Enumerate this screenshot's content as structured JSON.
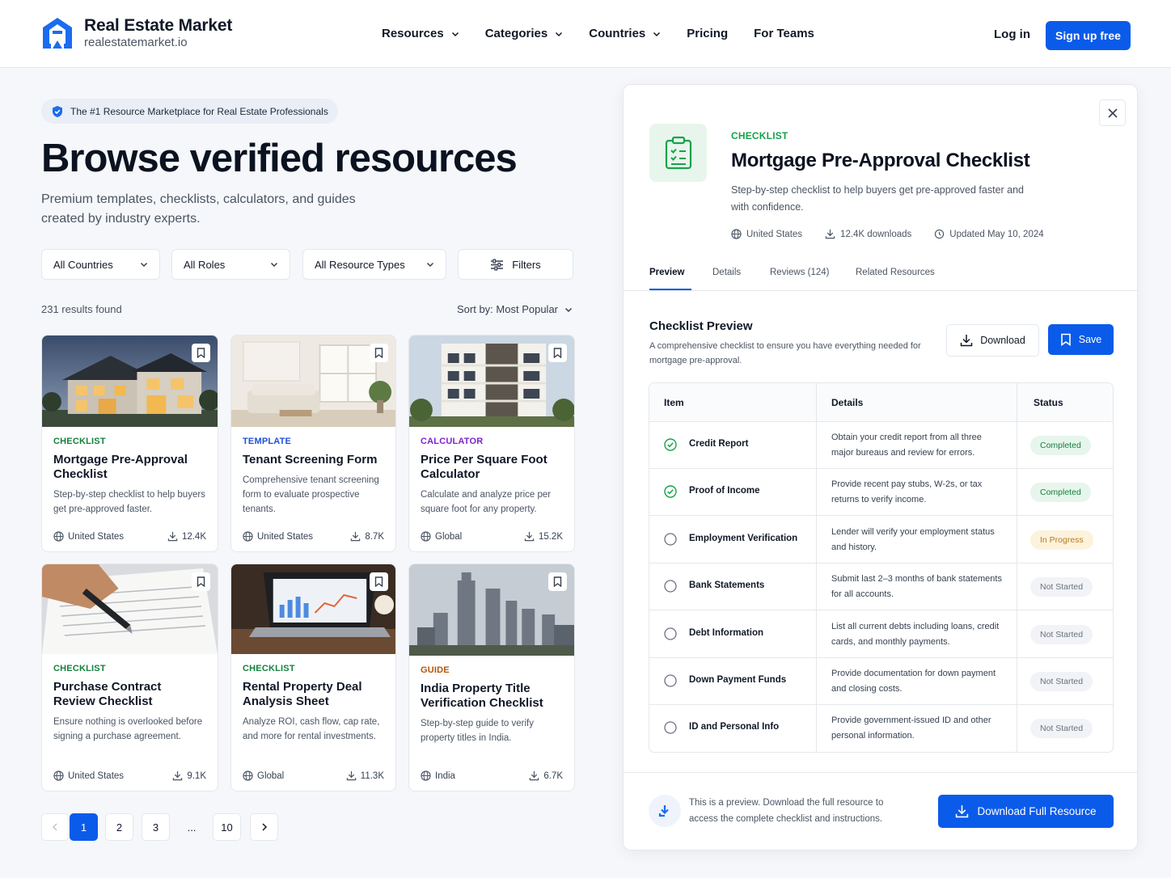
{
  "header": {
    "brand_name": "Real Estate Market",
    "brand_domain": "realestatemarket.io",
    "nav": [
      {
        "label": "Resources",
        "has_menu": true
      },
      {
        "label": "Categories",
        "has_menu": true
      },
      {
        "label": "Countries",
        "has_menu": true
      },
      {
        "label": "Pricing",
        "has_menu": false
      },
      {
        "label": "For Teams",
        "has_menu": false
      }
    ],
    "login": "Log in",
    "signup": "Sign up free"
  },
  "hero": {
    "badge": "The #1 Resource Marketplace for Real Estate Professionals",
    "title": "Browse verified resources",
    "subtitle": "Premium templates, checklists, calculators, and guides created by industry experts."
  },
  "filters": {
    "country": "All Countries",
    "roles": "All Roles",
    "types": "All Resource Types",
    "filters_label": "Filters"
  },
  "results": {
    "count_text": "231 results found",
    "sort_text": "Sort by: Most Popular"
  },
  "cards": [
    {
      "category": "CHECKLIST",
      "cat_color": "#15803d",
      "title": "Mortgage Pre-Approval Checklist",
      "desc": "Step-by-step checklist to help buyers get pre-approved faster.",
      "region": "United States",
      "downloads": "12.4K",
      "image": "house"
    },
    {
      "category": "TEMPLATE",
      "cat_color": "#1d4ed8",
      "title": "Tenant Screening Form",
      "desc": "Comprehensive tenant screening form to evaluate prospective tenants.",
      "region": "United States",
      "downloads": "8.7K",
      "image": "living-room"
    },
    {
      "category": "CALCULATOR",
      "cat_color": "#7e22ce",
      "title": "Price Per Square Foot Calculator",
      "desc": "Calculate and analyze price per square foot for any property.",
      "region": "Global",
      "downloads": "15.2K",
      "image": "apartment"
    },
    {
      "category": "CHECKLIST",
      "cat_color": "#15803d",
      "title": "Purchase Contract Review Checklist",
      "desc": "Ensure nothing is overlooked before signing a purchase agreement.",
      "region": "United States",
      "downloads": "9.1K",
      "image": "contract"
    },
    {
      "category": "CHECKLIST",
      "cat_color": "#15803d",
      "title": "Rental Property Deal Analysis Sheet",
      "desc": "Analyze ROI, cash flow, cap rate, and more for rental investments.",
      "region": "Global",
      "downloads": "11.3K",
      "image": "laptop"
    },
    {
      "category": "GUIDE",
      "cat_color": "#b45309",
      "title": "India Property Title Verification Checklist",
      "desc": "Step-by-step guide to verify property titles in India.",
      "region": "India",
      "downloads": "6.7K",
      "image": "skyline"
    }
  ],
  "pagination": {
    "pages": [
      "1",
      "2",
      "3",
      "...",
      "10"
    ],
    "current": "1"
  },
  "detail": {
    "category": "CHECKLIST",
    "title": "Mortgage Pre-Approval Checklist",
    "desc": "Step-by-step checklist to help buyers get pre-approved faster and with confidence.",
    "meta_region": "United States",
    "meta_downloads": "12.4K downloads",
    "meta_updated": "Updated May 10, 2024",
    "tabs": [
      "Preview",
      "Details",
      "Reviews (124)",
      "Related Resources"
    ],
    "active_tab": "Preview",
    "preview_title": "Checklist Preview",
    "preview_desc": "A comprehensive checklist to ensure you have everything needed for mortgage pre-approval.",
    "download_label": "Download",
    "save_label": "Save",
    "table_headers": [
      "Item",
      "Details",
      "Status"
    ],
    "rows": [
      {
        "item": "Credit Report",
        "details": "Obtain your credit report from all three major bureaus and review for errors.",
        "status": "Completed",
        "checked": true
      },
      {
        "item": "Proof of Income",
        "details": "Provide recent pay stubs, W-2s, or tax returns to verify income.",
        "status": "Completed",
        "checked": true
      },
      {
        "item": "Employment Verification",
        "details": "Lender will verify your employment status and history.",
        "status": "In Progress",
        "checked": false
      },
      {
        "item": "Bank Statements",
        "details": "Submit last 2–3 months of bank statements for all accounts.",
        "status": "Not Started",
        "checked": false
      },
      {
        "item": "Debt Information",
        "details": "List all current debts including loans, credit cards, and monthly payments.",
        "status": "Not Started",
        "checked": false
      },
      {
        "item": "Down Payment Funds",
        "details": "Provide documentation for down payment and closing costs.",
        "status": "Not Started",
        "checked": false
      },
      {
        "item": "ID and Personal Info",
        "details": "Provide government-issued ID and other personal information.",
        "status": "Not Started",
        "checked": false
      }
    ],
    "footer_note": "This is a preview. Download the full resource to access the complete checklist and instructions.",
    "download_full_label": "Download Full Resource"
  },
  "colors": {
    "primary": "#0b5bea",
    "success": "#16a34a"
  }
}
